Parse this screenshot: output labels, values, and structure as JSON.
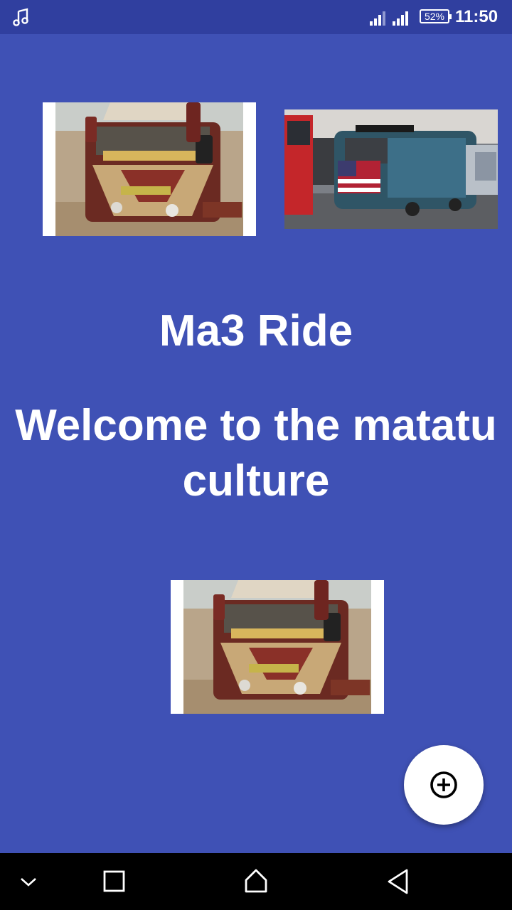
{
  "status_bar": {
    "battery": "52%",
    "time": "11:50",
    "icons": [
      "music-note-icon",
      "cell-signal-icon",
      "cell-signal-icon",
      "battery-icon"
    ]
  },
  "main": {
    "title": "Ma3 Ride",
    "welcome": "Welcome to the matatu culture",
    "images": [
      "matatu-front-photo",
      "matatu-street-photo",
      "matatu-front-photo"
    ]
  },
  "fab": {
    "icon": "add-circle-icon"
  },
  "nav_bar": {
    "icons": [
      "chevron-down-icon",
      "recents-square-icon",
      "home-icon",
      "back-triangle-icon"
    ]
  },
  "colors": {
    "status_bar": "#303f9f",
    "background": "#3f51b5",
    "text": "#ffffff",
    "fab": "#ffffff",
    "nav_bar": "#000000"
  }
}
